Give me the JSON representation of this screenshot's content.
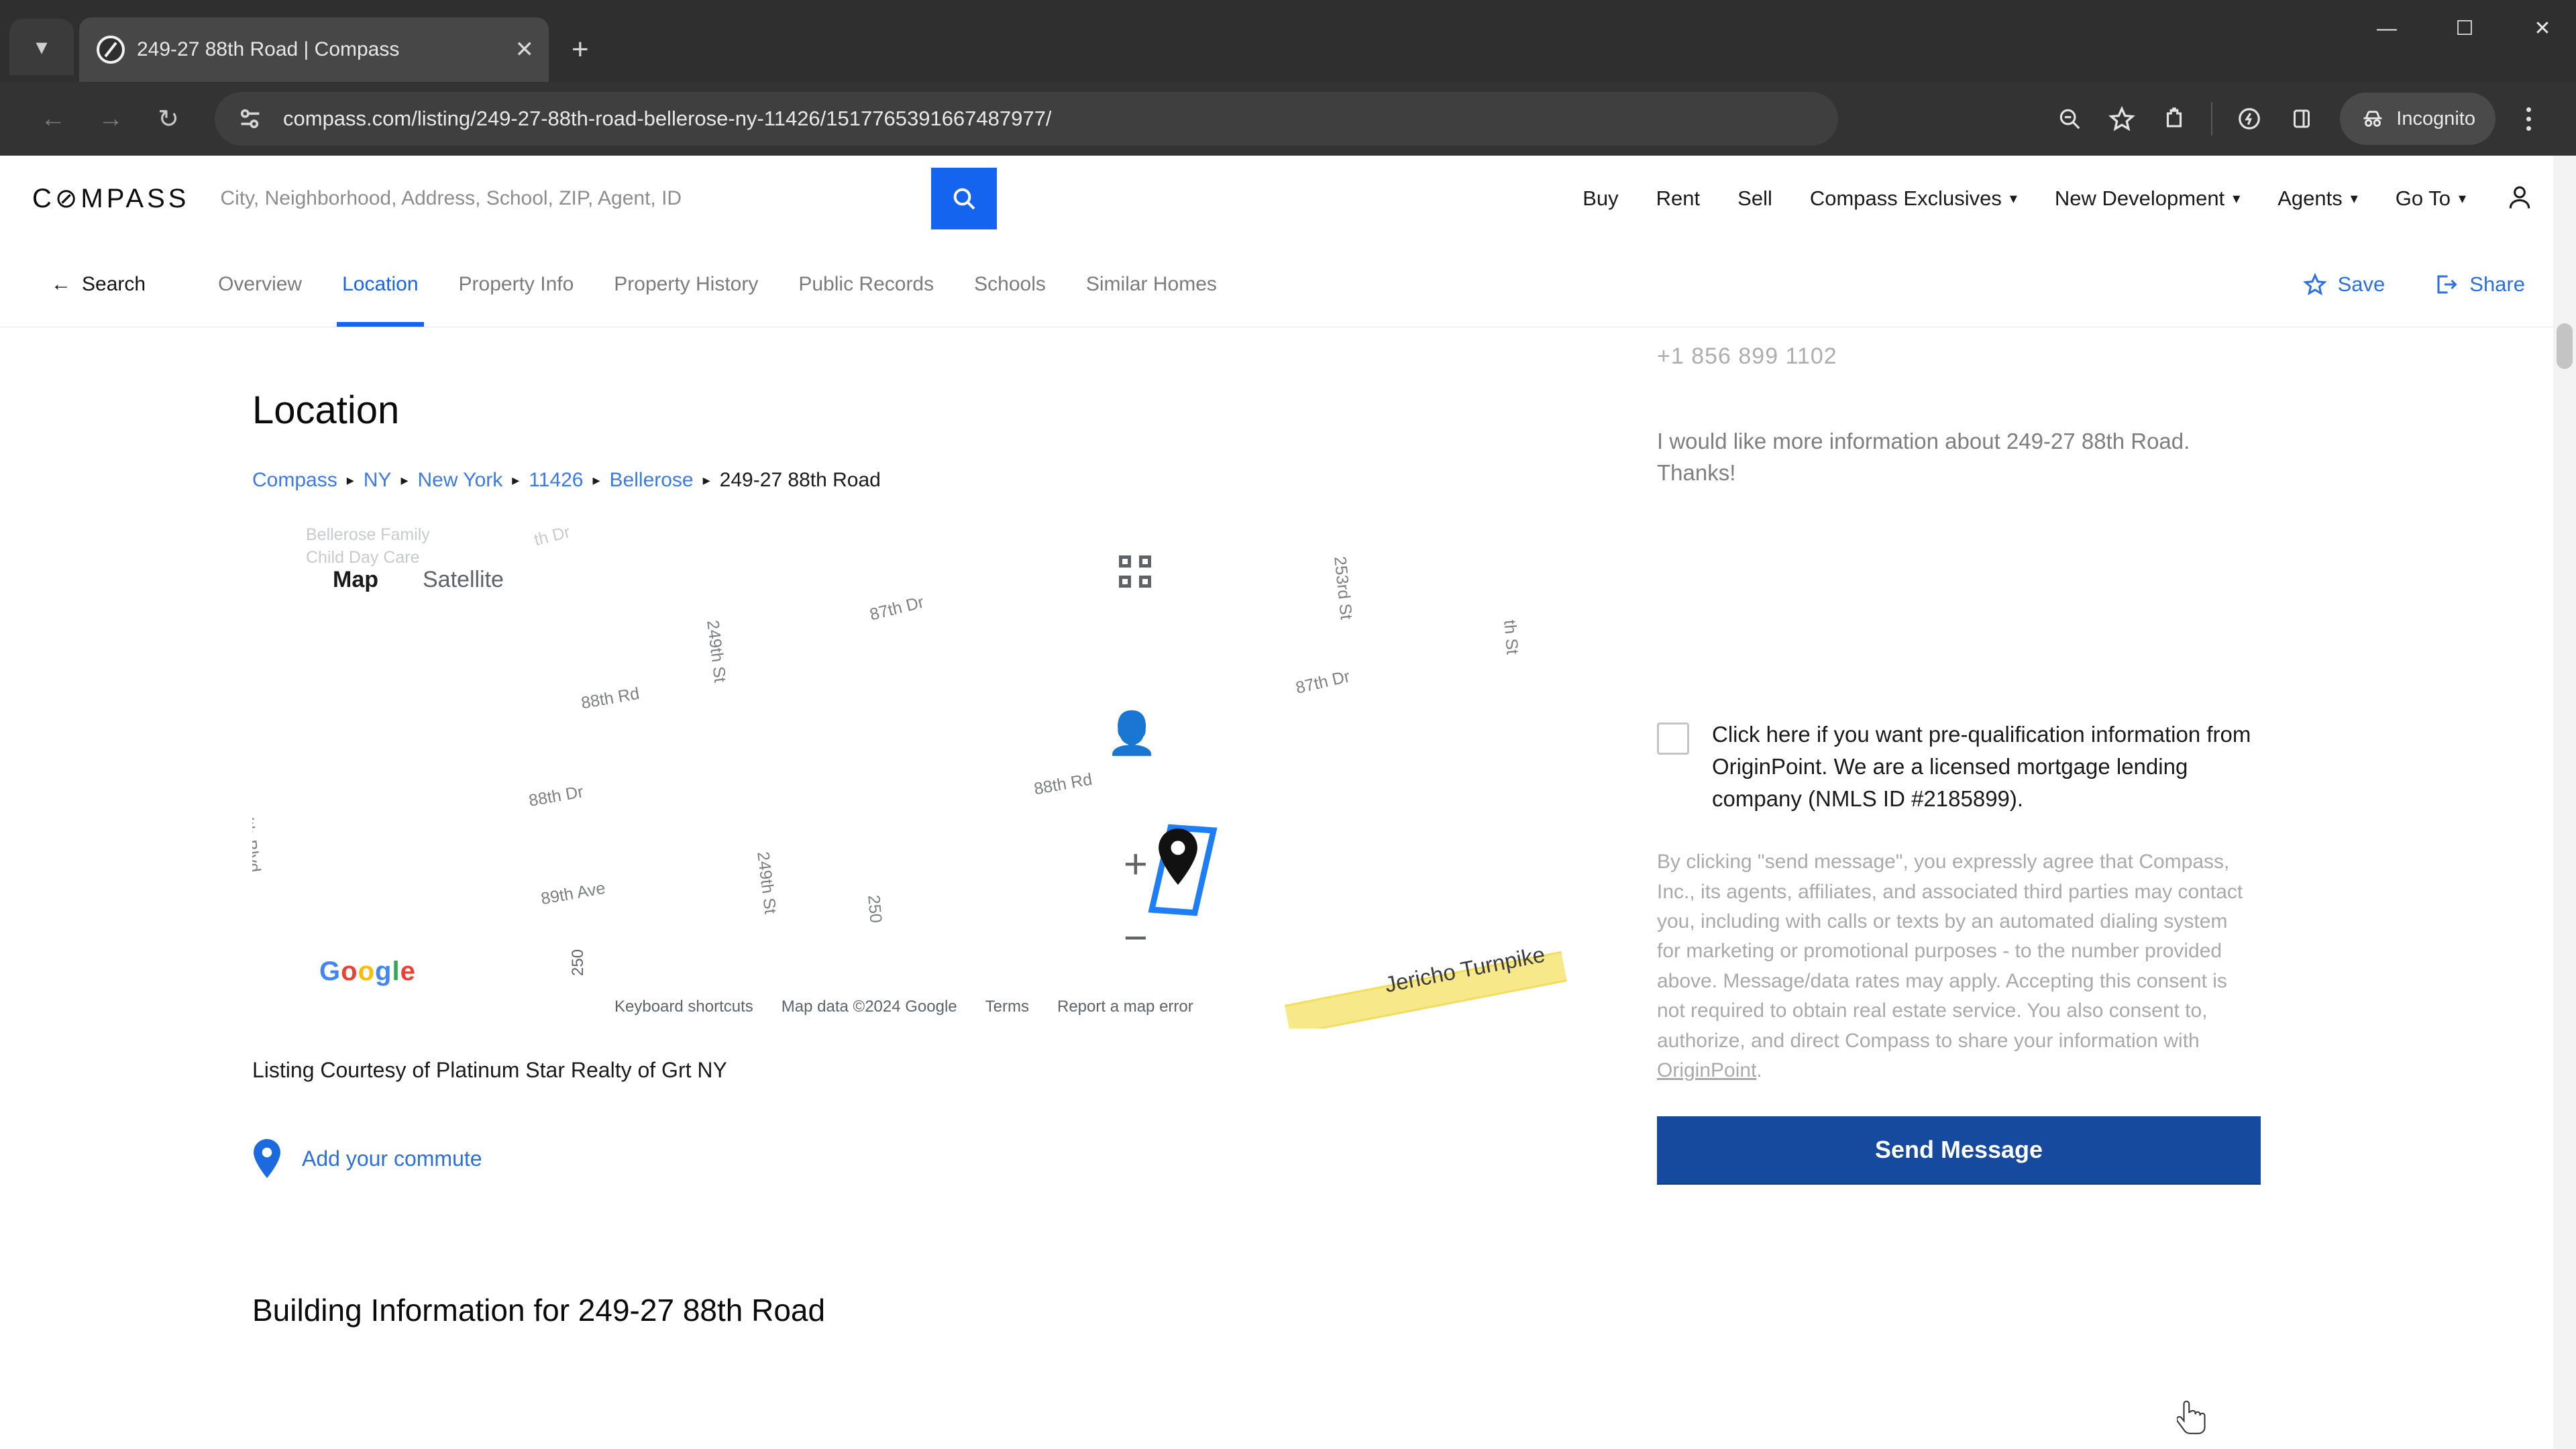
{
  "browser": {
    "tab": {
      "title": "249-27 88th Road | Compass",
      "favicon_icon": "compass-favicon",
      "close_icon": "close-icon"
    },
    "tab_list_icon": "chevron-down-icon",
    "new_tab_icon": "plus-icon",
    "window_controls": {
      "minimize": "minimize-icon",
      "maximize": "maximize-icon",
      "close": "close-icon"
    },
    "nav": {
      "back_icon": "arrow-left-icon",
      "forward_icon": "arrow-right-icon",
      "reload_icon": "reload-icon"
    },
    "omnibox": {
      "site_info_icon": "page-settings-icon",
      "url": "compass.com/listing/249-27-88th-road-bellerose-ny-11426/1517765391667487977/"
    },
    "toolbar_icons": [
      "zoom-out-icon",
      "bookmark-star-icon",
      "extensions-puzzle-icon",
      "performance-icon",
      "side-panel-icon"
    ],
    "incognito_label": "Incognito",
    "incognito_icon": "incognito-hat-icon",
    "menu_icon": "kebab-menu-icon"
  },
  "site_header": {
    "logo": "C⊘MPASS",
    "search_placeholder": "City, Neighborhood, Address, School, ZIP, Agent, ID",
    "search_value": "",
    "search_button_icon": "search-icon",
    "search_button_color": "#1464f0",
    "nav_items": [
      {
        "label": "Buy",
        "caret": false
      },
      {
        "label": "Rent",
        "caret": false
      },
      {
        "label": "Sell",
        "caret": false
      },
      {
        "label": "Compass Exclusives",
        "caret": true
      },
      {
        "label": "New Development",
        "caret": true
      },
      {
        "label": "Agents",
        "caret": true
      },
      {
        "label": "Go To",
        "caret": true
      }
    ],
    "account_icon": "person-icon"
  },
  "sub_nav": {
    "back_label": "Search",
    "back_icon": "arrow-left-icon",
    "tabs": [
      {
        "label": "Overview",
        "active": false
      },
      {
        "label": "Location",
        "active": true
      },
      {
        "label": "Property Info",
        "active": false
      },
      {
        "label": "Property History",
        "active": false
      },
      {
        "label": "Public Records",
        "active": false
      },
      {
        "label": "Schools",
        "active": false
      },
      {
        "label": "Similar Homes",
        "active": false
      }
    ],
    "active_color": "#1464f0",
    "actions": [
      {
        "label": "Save",
        "icon": "star-outline-icon"
      },
      {
        "label": "Share",
        "icon": "share-arrow-icon"
      }
    ]
  },
  "location_section": {
    "title": "Location",
    "breadcrumb": [
      {
        "label": "Compass",
        "link": true
      },
      {
        "label": "NY",
        "link": true
      },
      {
        "label": "New York",
        "link": true
      },
      {
        "label": "11426",
        "link": true
      },
      {
        "label": "Bellerose",
        "link": true
      },
      {
        "label": "249-27 88th Road",
        "link": false
      }
    ],
    "breadcrumb_separator": "▸",
    "courtesy": "Listing Courtesy of Platinum Star Realty of Grt NY",
    "commute_label": "Add your commute",
    "commute_icon": "map-pin-icon"
  },
  "map": {
    "toggle": [
      {
        "label": "Map",
        "selected": true
      },
      {
        "label": "Satellite",
        "selected": false
      }
    ],
    "street_labels": [
      "Bellerose Family",
      "Child Day Care",
      "th Dr",
      "87th Dr",
      "253rd St",
      "87th Dr",
      "249th St",
      "88th Rd",
      "88th Dr",
      "88th Rd",
      "249th St",
      "mmonwealth Blvd",
      "89th Ave",
      "th St",
      "250",
      "Jericho Turnpike"
    ],
    "controls": {
      "fullscreen_icon": "fullscreen-icon",
      "pegman_icon": "street-view-pegman-icon",
      "zoom_in_icon": "plus-icon",
      "zoom_out_icon": "minus-icon"
    },
    "google_logo": "Google",
    "attribution": [
      "Keyboard shortcuts",
      "Map data ©2024 Google",
      "Terms",
      "Report a map error"
    ],
    "marker_icon": "location-pin-marker",
    "parcel_outline_color": "#1e7ef5"
  },
  "contact_panel": {
    "phone_partial": "+1 856 899 1102",
    "message": "I would like more information about 249-27 88th Road.\nThanks!",
    "prequal_checkbox_label": "Click here if you want pre-qualification information from OriginPoint. We are a licensed mortgage lending company (NMLS ID #2185899).",
    "prequal_checked": false,
    "disclaimer": "By clicking \"send message\", you expressly agree that Compass, Inc., its agents, affiliates, and associated third parties may contact you, including with calls or texts by an automated dialing system for marketing or promotional purposes - to the number provided above. Message/data rates may apply. Accepting this consent is not required to obtain real estate service. You also consent to, authorize, and direct Compass to share your information with ",
    "disclaimer_link": "OriginPoint",
    "disclaimer_tail": ".",
    "send_button_label": "Send Message",
    "send_button_color": "#164a9e"
  },
  "building_section": {
    "title": "Building Information for 249-27 88th Road"
  }
}
